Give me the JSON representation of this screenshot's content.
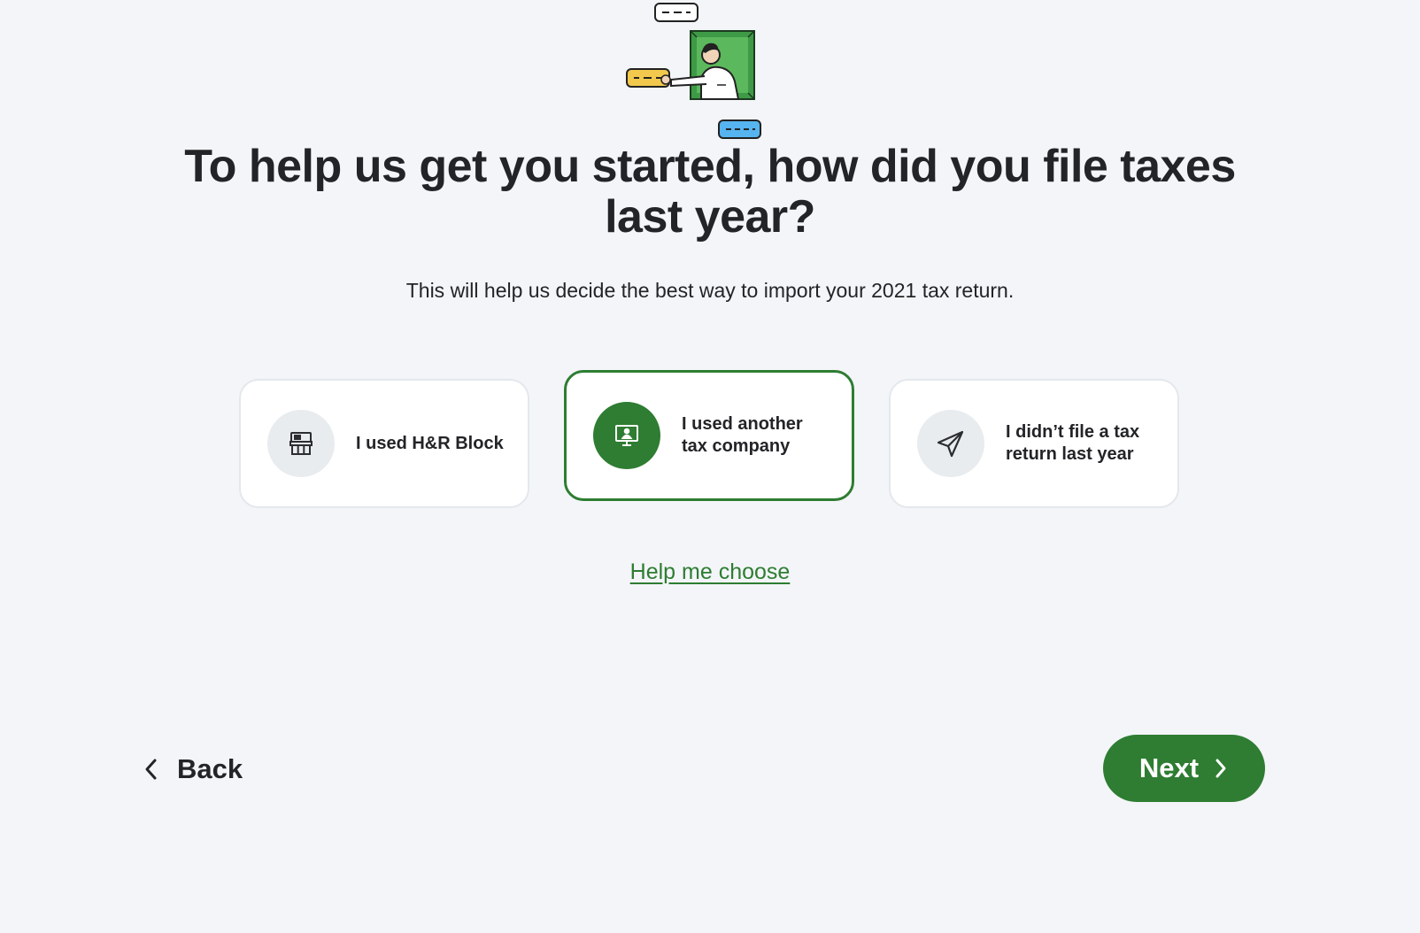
{
  "heading": {
    "title": "To help us get you started, how did you file taxes last year?",
    "subtitle": "This will help us decide the best way to import your 2021 tax return."
  },
  "options": [
    {
      "label": "I used H&R Block",
      "icon": "storefront-icon",
      "selected": false
    },
    {
      "label": "I used another tax company",
      "icon": "computer-monitor-person-icon",
      "selected": true
    },
    {
      "label": "I didn’t file a tax return last year",
      "icon": "paper-plane-icon",
      "selected": false
    }
  ],
  "help_link": "Help me choose",
  "nav": {
    "back_label": "Back",
    "next_label": "Next"
  },
  "colors": {
    "background": "#f3f5f8",
    "accent_green": "#2e7d32",
    "text": "#232427",
    "icon_circle": "#e8ecef"
  }
}
